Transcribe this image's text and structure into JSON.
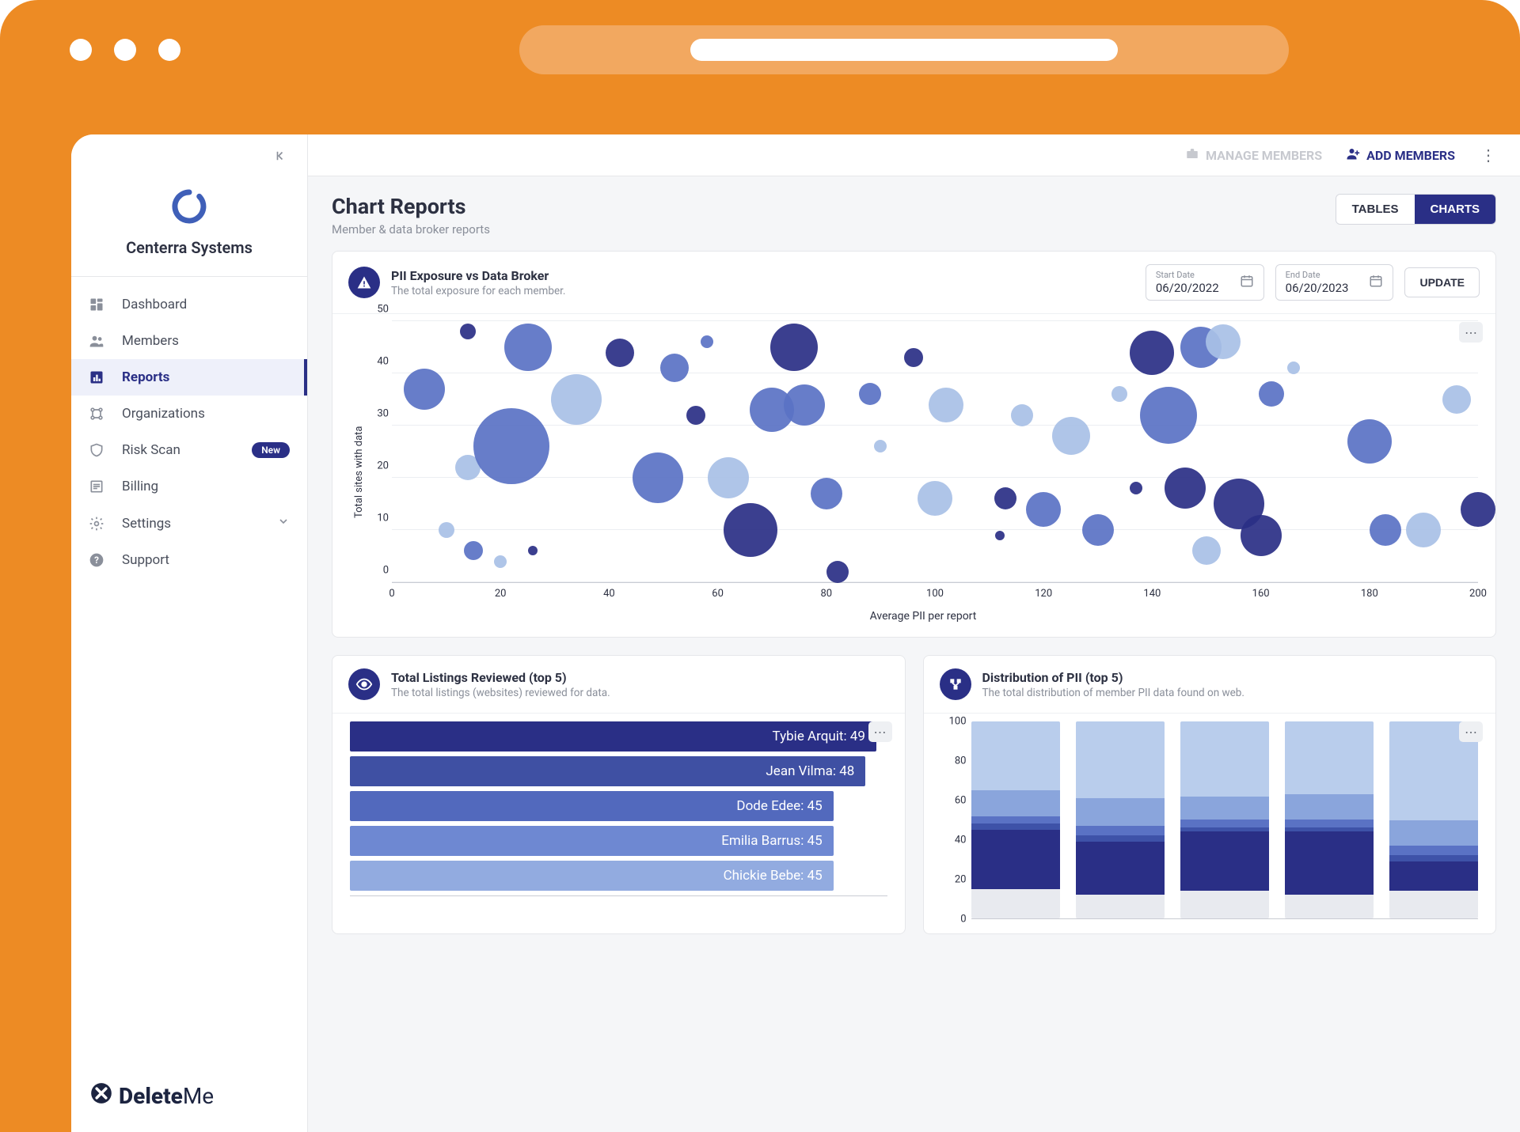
{
  "org": {
    "name": "Centerra Systems"
  },
  "sidebar": {
    "items": [
      {
        "label": "Dashboard"
      },
      {
        "label": "Members"
      },
      {
        "label": "Reports"
      },
      {
        "label": "Organizations"
      },
      {
        "label": "Risk Scan",
        "badge": "New"
      },
      {
        "label": "Billing"
      },
      {
        "label": "Settings"
      },
      {
        "label": "Support"
      }
    ]
  },
  "brand": {
    "prefix": "Delete",
    "suffix": "Me"
  },
  "topbar": {
    "manage": "MANAGE MEMBERS",
    "add": "ADD MEMBERS"
  },
  "page": {
    "title": "Chart Reports",
    "subtitle": "Member & data broker reports",
    "tab_tables": "TABLES",
    "tab_charts": "CHARTS"
  },
  "scatter_card": {
    "title": "PII Exposure vs Data Broker",
    "desc": "The total exposure for each member.",
    "start_label": "Start Date",
    "start_value": "06/20/2022",
    "end_label": "End Date",
    "end_value": "06/20/2023",
    "update": "UPDATE"
  },
  "listings_card": {
    "title": "Total Listings Reviewed (top 5)",
    "desc": "The total listings (websites) reviewed for data."
  },
  "dist_card": {
    "title": "Distribution of PII (top 5)",
    "desc": "The total distribution of member PII data found on web."
  },
  "chart_data": [
    {
      "id": "pii_exposure_scatter",
      "type": "scatter",
      "xlabel": "Average PII per report",
      "ylabel": "Total sites with data",
      "xlim": [
        0,
        200
      ],
      "ylim": [
        0,
        50
      ],
      "x_ticks": [
        0,
        20,
        40,
        60,
        80,
        100,
        120,
        140,
        160,
        180,
        200
      ],
      "y_ticks": [
        0,
        10,
        20,
        30,
        40,
        50
      ],
      "palette": {
        "dark": "#2a2f86",
        "mid": "#5a72c4",
        "light": "#a8c0e6"
      },
      "points": [
        {
          "x": 6,
          "y": 37,
          "r": 26,
          "c": "mid"
        },
        {
          "x": 10,
          "y": 10,
          "r": 10,
          "c": "light"
        },
        {
          "x": 14,
          "y": 48,
          "r": 10,
          "c": "dark"
        },
        {
          "x": 15,
          "y": 6,
          "r": 12,
          "c": "mid"
        },
        {
          "x": 14,
          "y": 22,
          "r": 16,
          "c": "light"
        },
        {
          "x": 20,
          "y": 4,
          "r": 8,
          "c": "light"
        },
        {
          "x": 22,
          "y": 26,
          "r": 48,
          "c": "mid"
        },
        {
          "x": 25,
          "y": 45,
          "r": 30,
          "c": "mid"
        },
        {
          "x": 26,
          "y": 6,
          "r": 6,
          "c": "dark"
        },
        {
          "x": 34,
          "y": 35,
          "r": 32,
          "c": "light"
        },
        {
          "x": 42,
          "y": 44,
          "r": 18,
          "c": "dark"
        },
        {
          "x": 52,
          "y": 41,
          "r": 18,
          "c": "mid"
        },
        {
          "x": 49,
          "y": 20,
          "r": 32,
          "c": "mid"
        },
        {
          "x": 56,
          "y": 32,
          "r": 12,
          "c": "dark"
        },
        {
          "x": 58,
          "y": 46,
          "r": 8,
          "c": "mid"
        },
        {
          "x": 62,
          "y": 20,
          "r": 26,
          "c": "light"
        },
        {
          "x": 66,
          "y": 10,
          "r": 34,
          "c": "dark"
        },
        {
          "x": 70,
          "y": 33,
          "r": 28,
          "c": "mid"
        },
        {
          "x": 74,
          "y": 45,
          "r": 30,
          "c": "dark"
        },
        {
          "x": 76,
          "y": 34,
          "r": 26,
          "c": "mid"
        },
        {
          "x": 80,
          "y": 17,
          "r": 20,
          "c": "mid"
        },
        {
          "x": 82,
          "y": 2,
          "r": 14,
          "c": "dark"
        },
        {
          "x": 88,
          "y": 36,
          "r": 14,
          "c": "mid"
        },
        {
          "x": 90,
          "y": 26,
          "r": 8,
          "c": "light"
        },
        {
          "x": 96,
          "y": 43,
          "r": 12,
          "c": "dark"
        },
        {
          "x": 100,
          "y": 16,
          "r": 22,
          "c": "light"
        },
        {
          "x": 102,
          "y": 34,
          "r": 22,
          "c": "light"
        },
        {
          "x": 112,
          "y": 9,
          "r": 6,
          "c": "dark"
        },
        {
          "x": 113,
          "y": 16,
          "r": 14,
          "c": "dark"
        },
        {
          "x": 116,
          "y": 32,
          "r": 14,
          "c": "light"
        },
        {
          "x": 120,
          "y": 14,
          "r": 22,
          "c": "mid"
        },
        {
          "x": 125,
          "y": 28,
          "r": 24,
          "c": "light"
        },
        {
          "x": 130,
          "y": 10,
          "r": 20,
          "c": "mid"
        },
        {
          "x": 134,
          "y": 36,
          "r": 10,
          "c": "light"
        },
        {
          "x": 137,
          "y": 18,
          "r": 8,
          "c": "dark"
        },
        {
          "x": 140,
          "y": 44,
          "r": 28,
          "c": "dark"
        },
        {
          "x": 143,
          "y": 32,
          "r": 36,
          "c": "mid"
        },
        {
          "x": 146,
          "y": 18,
          "r": 26,
          "c": "dark"
        },
        {
          "x": 149,
          "y": 45,
          "r": 26,
          "c": "mid"
        },
        {
          "x": 150,
          "y": 6,
          "r": 18,
          "c": "light"
        },
        {
          "x": 153,
          "y": 46,
          "r": 22,
          "c": "light"
        },
        {
          "x": 156,
          "y": 15,
          "r": 32,
          "c": "dark"
        },
        {
          "x": 160,
          "y": 9,
          "r": 26,
          "c": "dark"
        },
        {
          "x": 162,
          "y": 36,
          "r": 16,
          "c": "mid"
        },
        {
          "x": 166,
          "y": 41,
          "r": 8,
          "c": "light"
        },
        {
          "x": 180,
          "y": 27,
          "r": 28,
          "c": "mid"
        },
        {
          "x": 183,
          "y": 10,
          "r": 20,
          "c": "mid"
        },
        {
          "x": 190,
          "y": 10,
          "r": 22,
          "c": "light"
        },
        {
          "x": 196,
          "y": 35,
          "r": 18,
          "c": "light"
        },
        {
          "x": 200,
          "y": 14,
          "r": 22,
          "c": "dark"
        }
      ]
    },
    {
      "id": "listings_hbar",
      "type": "bar",
      "orientation": "horizontal",
      "xlim": [
        0,
        50
      ],
      "series": [
        {
          "name": "Tybie Arquit",
          "value": 49,
          "color": "#2a2f86"
        },
        {
          "name": "Jean Vilma",
          "value": 48,
          "color": "#3f50a3"
        },
        {
          "name": "Dode Edee",
          "value": 45,
          "color": "#5269bd"
        },
        {
          "name": "Emilia Barrus",
          "value": 45,
          "color": "#6e88d2"
        },
        {
          "name": "Chickie Bebe",
          "value": 45,
          "color": "#92abe0"
        }
      ]
    },
    {
      "id": "dist_stacked",
      "type": "bar",
      "stacked": true,
      "ylim": [
        0,
        100
      ],
      "y_ticks": [
        0,
        20,
        40,
        60,
        80,
        100
      ],
      "slice_colors": [
        "#e8eaef",
        "#2a2f86",
        "#3e52a8",
        "#5a72c4",
        "#8aa5dc",
        "#b9cdec"
      ],
      "columns": [
        [
          15,
          30,
          3,
          4,
          13,
          35
        ],
        [
          12,
          27,
          3,
          5,
          14,
          39
        ],
        [
          14,
          30,
          2,
          4,
          12,
          38
        ],
        [
          12,
          32,
          2,
          4,
          13,
          37
        ],
        [
          14,
          15,
          3,
          5,
          13,
          50
        ]
      ]
    }
  ]
}
